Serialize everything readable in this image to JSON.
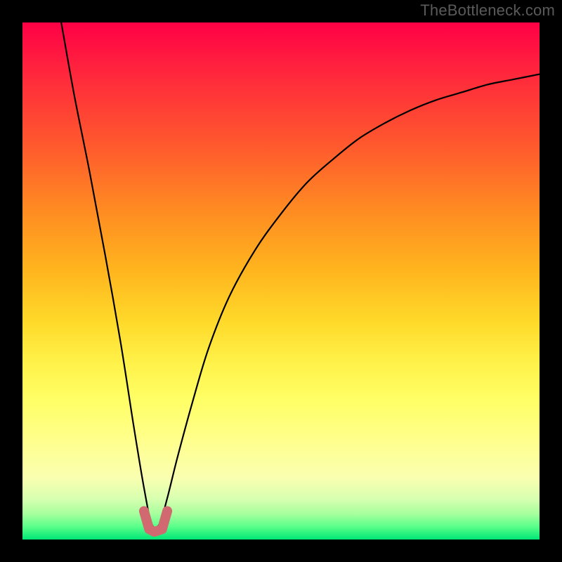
{
  "attribution": "TheBottleneck.com",
  "chart_data": {
    "type": "line",
    "title": "",
    "xlabel": "",
    "ylabel": "",
    "x_range": [
      0,
      1
    ],
    "y_range": [
      0,
      1
    ],
    "series": [
      {
        "name": "bottleneck-curve",
        "x": [
          0.075,
          0.1,
          0.13,
          0.16,
          0.19,
          0.215,
          0.235,
          0.25,
          0.265,
          0.28,
          0.3,
          0.33,
          0.36,
          0.4,
          0.45,
          0.5,
          0.55,
          0.6,
          0.65,
          0.7,
          0.75,
          0.8,
          0.85,
          0.9,
          0.95,
          1.0
        ],
        "y": [
          1.0,
          0.86,
          0.71,
          0.55,
          0.38,
          0.22,
          0.1,
          0.03,
          0.03,
          0.08,
          0.16,
          0.27,
          0.37,
          0.47,
          0.56,
          0.63,
          0.69,
          0.735,
          0.775,
          0.805,
          0.83,
          0.85,
          0.865,
          0.88,
          0.89,
          0.9
        ]
      }
    ],
    "optimal_marker": {
      "name": "optimal-range",
      "x": [
        0.235,
        0.245,
        0.255,
        0.27,
        0.28
      ],
      "y": [
        0.055,
        0.02,
        0.015,
        0.02,
        0.055
      ]
    },
    "background_gradient_stops": [
      {
        "pos": 0.0,
        "color": "#ff0046"
      },
      {
        "pos": 0.12,
        "color": "#ff2f3a"
      },
      {
        "pos": 0.24,
        "color": "#ff5a2d"
      },
      {
        "pos": 0.36,
        "color": "#ff8a22"
      },
      {
        "pos": 0.48,
        "color": "#ffb51e"
      },
      {
        "pos": 0.58,
        "color": "#ffda2a"
      },
      {
        "pos": 0.66,
        "color": "#fff24a"
      },
      {
        "pos": 0.73,
        "color": "#ffff66"
      },
      {
        "pos": 0.8,
        "color": "#ffff88"
      },
      {
        "pos": 0.88,
        "color": "#faffb0"
      },
      {
        "pos": 0.92,
        "color": "#d9ffb0"
      },
      {
        "pos": 0.95,
        "color": "#a8ff9e"
      },
      {
        "pos": 0.975,
        "color": "#5aff8a"
      },
      {
        "pos": 1.0,
        "color": "#00e676"
      }
    ]
  }
}
